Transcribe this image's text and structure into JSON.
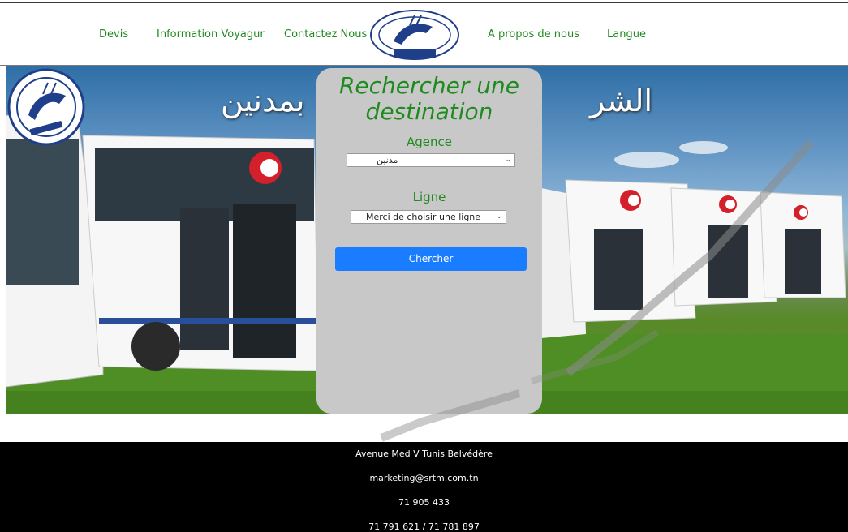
{
  "nav": {
    "items": [
      "Devis",
      "Information Voyagur",
      "Contactez Nous",
      "A propos de nous",
      "Langue"
    ]
  },
  "hero": {
    "arabic_left": "بمدنين",
    "arabic_right": "الشر"
  },
  "search": {
    "title_line1": "Rechercher une",
    "title_line2": "destination",
    "agence_label": "Agence",
    "agence_value": "مدنين",
    "ligne_label": "Ligne",
    "ligne_value": "Merci de choisir une ligne",
    "button_label": "Chercher"
  },
  "footer": {
    "address": "Avenue Med V Tunis Belvédère",
    "email": "marketing@srtm.com.tn",
    "phone1": "71 905 433",
    "phone2": "71 791 621 / 71 781 897"
  },
  "colors": {
    "accent_green": "#1e8b1e",
    "button_blue": "#1a7cff",
    "panel_gray": "#c8c8c8",
    "footer_black": "#000000"
  }
}
